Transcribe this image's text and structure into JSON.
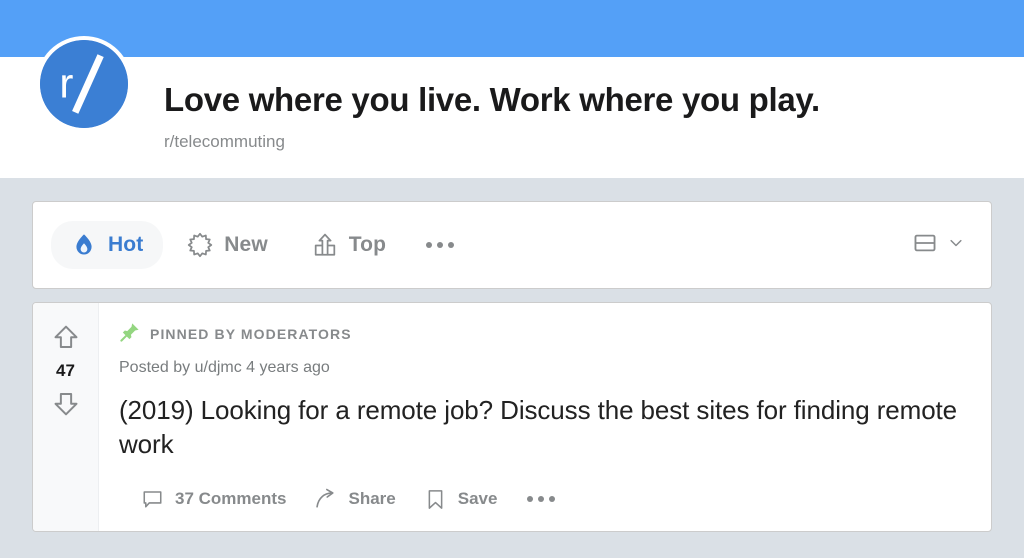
{
  "theme": {
    "banner_color": "#54A0F7",
    "page_background": "#DAE0E6",
    "accent_blue": "#3A7CD0",
    "avatar_blue": "#3B7FD4",
    "muted_text": "#878A8C",
    "pin_green": "#94D681"
  },
  "header": {
    "avatar_text": "r/",
    "avatar_icon": "subreddit-avatar-icon",
    "title": "Love where you live. Work where you play.",
    "subreddit": "r/telecommuting"
  },
  "sortbar": {
    "tabs": [
      {
        "label": "Hot",
        "icon": "flame-icon",
        "active": true
      },
      {
        "label": "New",
        "icon": "starburst-icon",
        "active": false
      },
      {
        "label": "Top",
        "icon": "podium-up-arrow-icon",
        "active": false
      }
    ],
    "more_icon": "ellipsis-icon",
    "view_icon": "card-layout-icon",
    "view_chevron_icon": "chevron-down-icon"
  },
  "post": {
    "vote": {
      "upvote_icon": "upvote-arrow-icon",
      "downvote_icon": "downvote-arrow-icon",
      "score": "47"
    },
    "pinned_icon": "pin-icon",
    "pinned_label": "PINNED BY MODERATORS",
    "meta": "Posted by u/djmc 4 years ago",
    "title": "(2019) Looking for a remote job? Discuss the best sites for finding remote work",
    "actions": [
      {
        "label": "37 Comments",
        "icon": "comment-bubble-icon"
      },
      {
        "label": "Share",
        "icon": "share-arrow-icon"
      },
      {
        "label": "Save",
        "icon": "bookmark-icon"
      }
    ],
    "more_icon": "ellipsis-icon"
  }
}
